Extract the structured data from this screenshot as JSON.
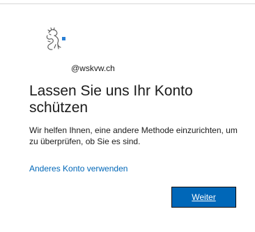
{
  "account": {
    "email": "@wskvw.ch"
  },
  "title": "Lassen Sie uns Ihr Konto schützen",
  "description": "Wir helfen Ihnen, eine andere Methode einzurichten, um zu überprüfen, ob Sie es sind.",
  "links": {
    "other_account": "Anderes Konto verwenden"
  },
  "buttons": {
    "next_label": "Weiter"
  },
  "logo": {
    "icon": "lion-crest-icon",
    "accent_color": "#2a7fd4"
  },
  "colors": {
    "link": "#0067b8",
    "button_bg": "#0067b8",
    "button_text": "#ffffff"
  }
}
